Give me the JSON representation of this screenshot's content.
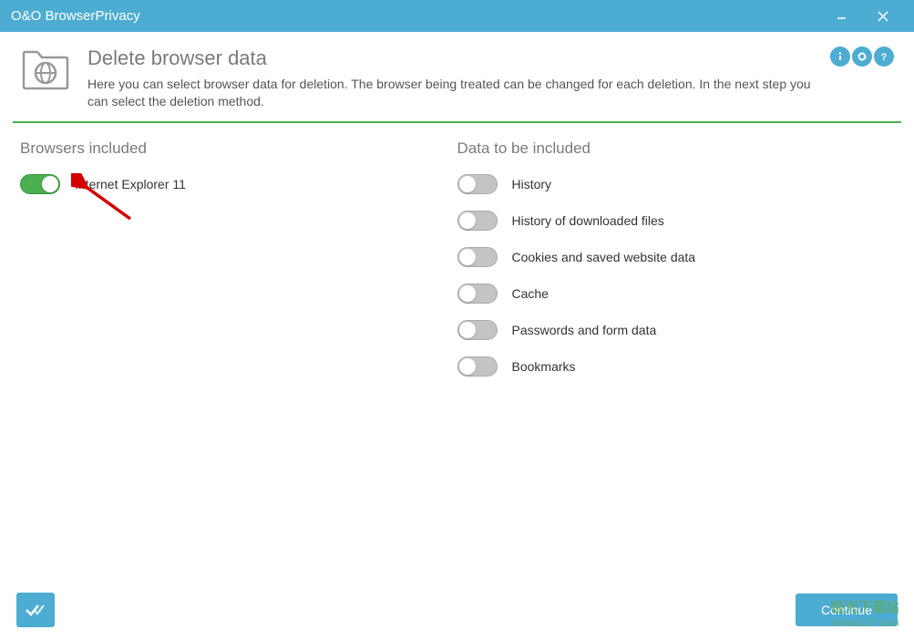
{
  "titlebar": {
    "title": "O&O BrowserPrivacy"
  },
  "header": {
    "title": "Delete browser data",
    "description": "Here you can select browser data for deletion. The browser being treated can be changed for each deletion. In the next step you can select the deletion method."
  },
  "browsers": {
    "section_title": "Browsers included",
    "items": [
      {
        "label": "Internet Explorer 11",
        "enabled": true
      }
    ]
  },
  "data_types": {
    "section_title": "Data to be included",
    "items": [
      {
        "label": "History",
        "enabled": false
      },
      {
        "label": "History of downloaded files",
        "enabled": false
      },
      {
        "label": "Cookies and saved website data",
        "enabled": false
      },
      {
        "label": "Cache",
        "enabled": false
      },
      {
        "label": "Passwords and form data",
        "enabled": false
      },
      {
        "label": "Bookmarks",
        "enabled": false
      }
    ]
  },
  "footer": {
    "continue_label": "Continue"
  },
  "watermark": {
    "line1": "极光下载站",
    "line2": "www.xz7.com"
  }
}
